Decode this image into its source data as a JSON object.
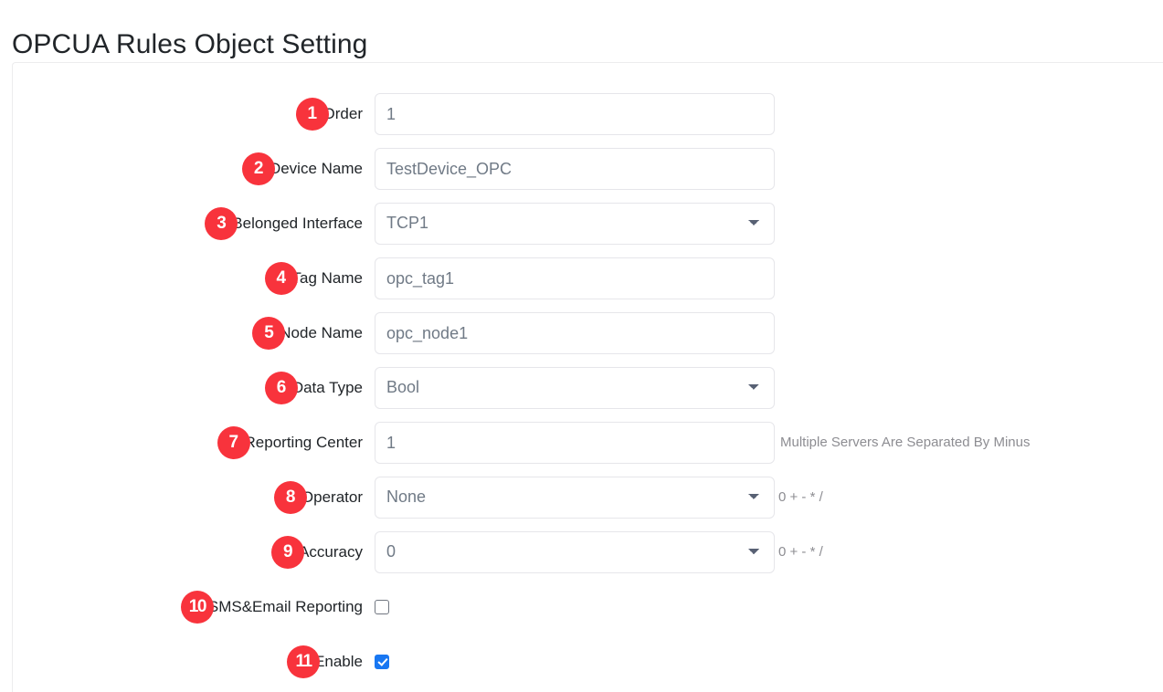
{
  "page": {
    "title": "OPCUA Rules Object Setting"
  },
  "form": {
    "rows": [
      {
        "badge": "1",
        "label": "Order",
        "type": "text",
        "value": "1",
        "hint": ""
      },
      {
        "badge": "2",
        "label": "Device Name",
        "type": "text",
        "value": "TestDevice_OPC",
        "hint": ""
      },
      {
        "badge": "3",
        "label": "Belonged Interface",
        "type": "select",
        "value": "TCP1",
        "hint": ""
      },
      {
        "badge": "4",
        "label": "Tag Name",
        "type": "text",
        "value": "opc_tag1",
        "hint": ""
      },
      {
        "badge": "5",
        "label": "Node Name",
        "type": "text",
        "value": "opc_node1",
        "hint": ""
      },
      {
        "badge": "6",
        "label": "Data Type",
        "type": "select",
        "value": "Bool",
        "hint": ""
      },
      {
        "badge": "7",
        "label": "Reporting Center",
        "type": "text",
        "value": "1",
        "hint": "Multiple Servers Are Separated By Minus"
      },
      {
        "badge": "8",
        "label": "Operator",
        "type": "select",
        "value": "None",
        "hint": "0 + - * /"
      },
      {
        "badge": "9",
        "label": "Accuracy",
        "type": "select",
        "value": "0",
        "hint": "0 + - * /"
      },
      {
        "badge": "10",
        "label": "SMS&Email Reporting",
        "type": "checkbox",
        "checked": false,
        "hint": ""
      },
      {
        "badge": "11",
        "label": "Enable",
        "type": "checkbox",
        "checked": true,
        "hint": ""
      }
    ]
  },
  "colors": {
    "badge_red": "#f8333c",
    "checkbox_blue": "#1877f2",
    "text_dark": "#212529",
    "text_muted": "#707a86",
    "hint_gray": "#8d8d92",
    "border_gray": "#e6e6ea"
  }
}
